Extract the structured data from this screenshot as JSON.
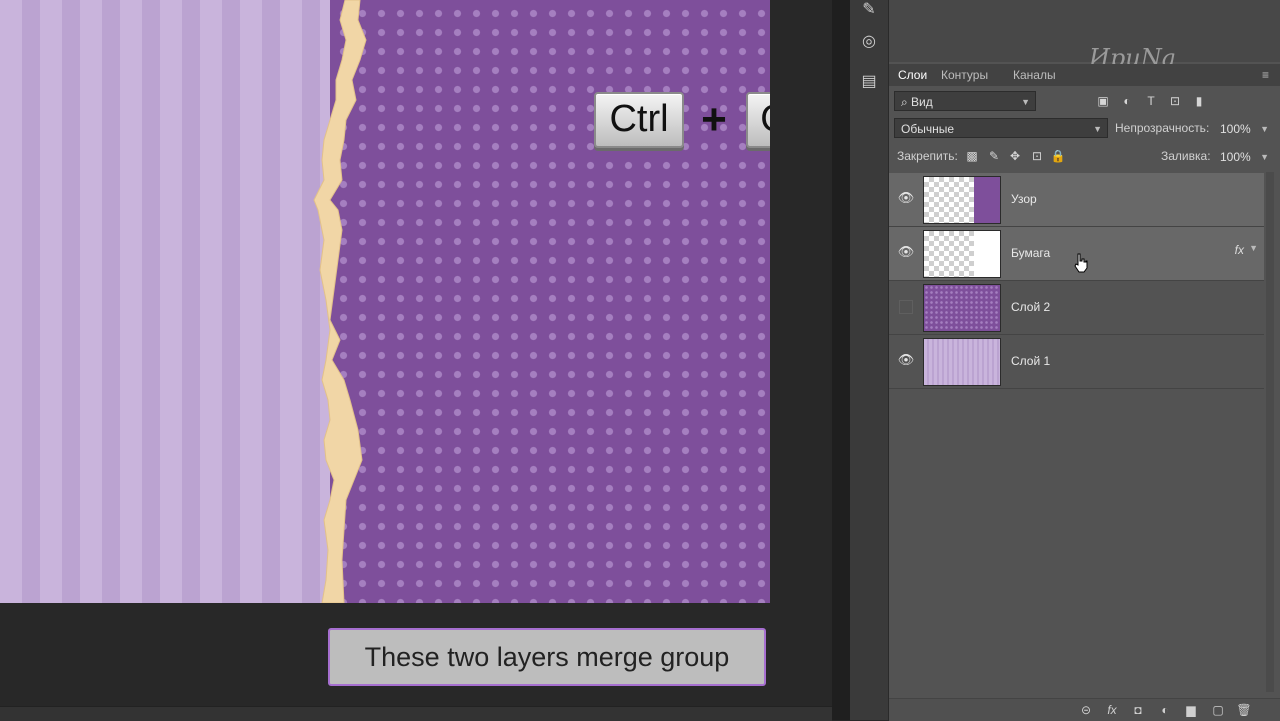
{
  "shortcut": {
    "key1": "Ctrl",
    "plus": "+",
    "key2": "G"
  },
  "caption": "These two layers merge group",
  "watermark": "ИриNa",
  "tools": {
    "tool1": "✎",
    "tool2": "◎",
    "tool3": "▤"
  },
  "panel": {
    "tabs": [
      "Слои",
      "Контуры",
      "Каналы"
    ],
    "menu_icon": "≡",
    "filter": {
      "label": "⌕ Вид",
      "icons": [
        "▣",
        "◐",
        "T",
        "⊡",
        "▮"
      ]
    },
    "blend_mode": "Обычные",
    "opacity_label": "Непрозрачность:",
    "opacity_value": "100%",
    "lock_label": "Закрепить:",
    "lock_icons": [
      "▩",
      "✎",
      "✥",
      "⊡",
      "🔒"
    ],
    "fill_label": "Заливка:",
    "fill_value": "100%",
    "layers": [
      {
        "name": "Узор",
        "visible": true,
        "selected": true,
        "fx": ""
      },
      {
        "name": "Бумага",
        "visible": true,
        "selected": true,
        "fx": "fx"
      },
      {
        "name": "Слой 2",
        "visible": false,
        "selected": false,
        "fx": ""
      },
      {
        "name": "Слой 1",
        "visible": true,
        "selected": false,
        "fx": ""
      }
    ],
    "eye_icon": "👁",
    "bottom_icons": [
      "⊝",
      "fx",
      "◘",
      "◐",
      "▆",
      "▢",
      "🗑"
    ]
  },
  "colors": {
    "stripe_light": "#c9b4dc",
    "stripe_dark": "#bba3d1",
    "dots_bg": "#7e4f9b",
    "dots": "#a57fc0",
    "torn_paper": "#f1d6a6",
    "caption_border": "#a66fd0"
  }
}
